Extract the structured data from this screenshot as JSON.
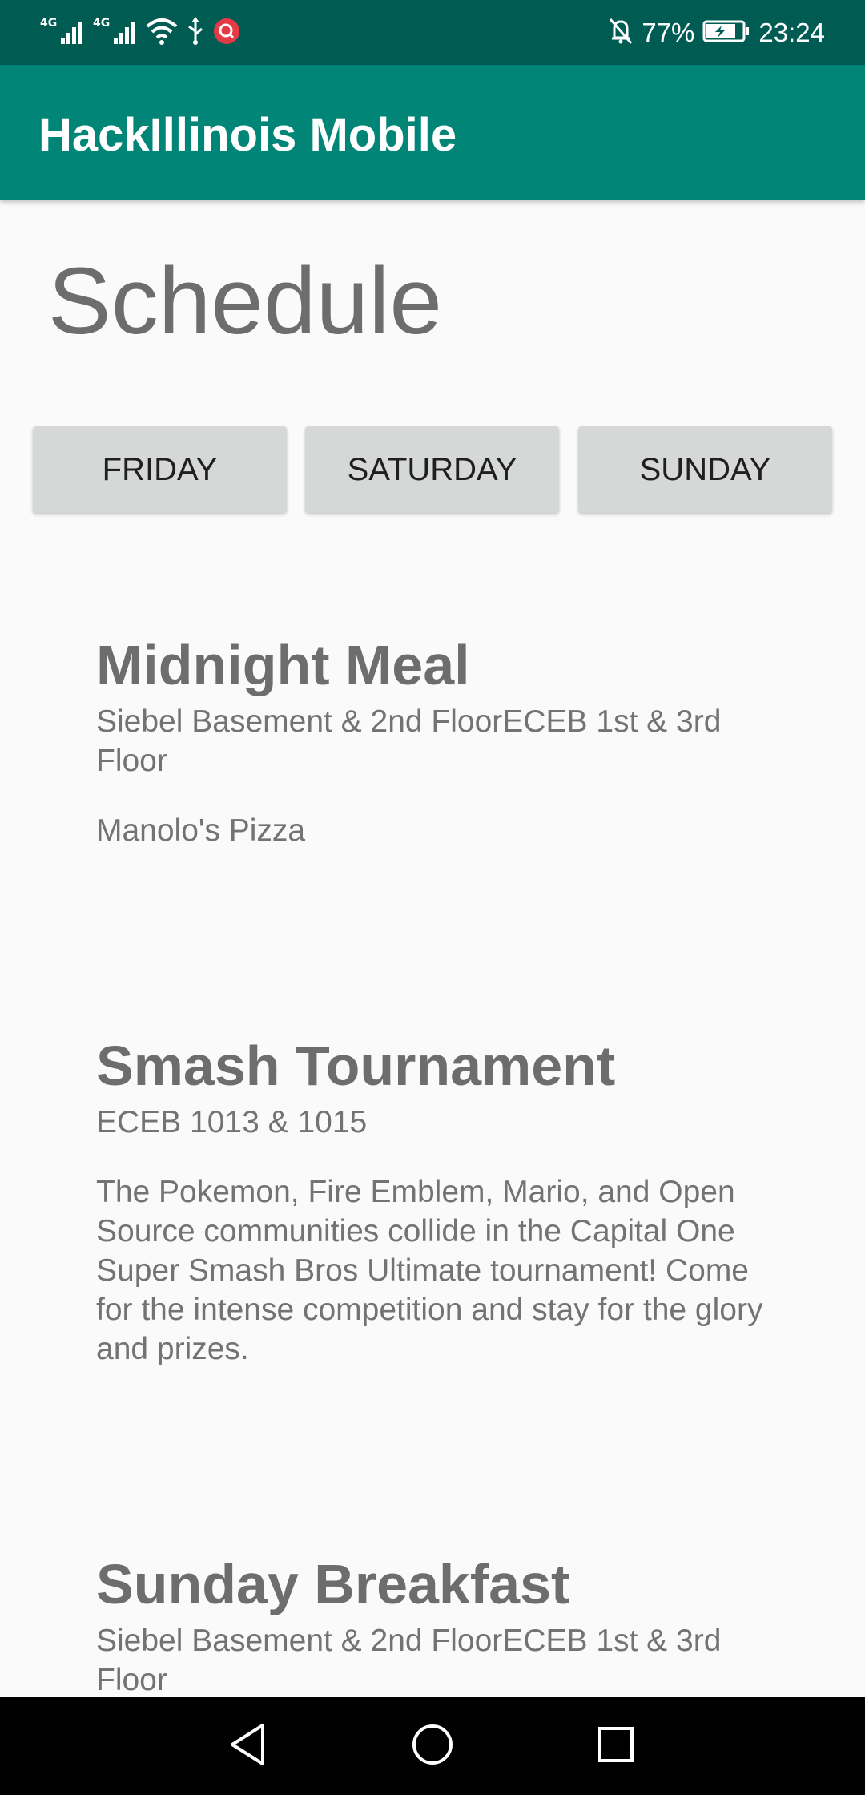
{
  "status_bar": {
    "signal_1": "4G",
    "signal_2": "4G",
    "battery_percent": "77%",
    "time": "23:24",
    "background": "#005c52",
    "icons": [
      "signal-4g-icon",
      "signal-4g-icon",
      "wifi-icon",
      "usb-icon",
      "notification-app-icon",
      "mute-bell-icon",
      "battery-charging-icon"
    ]
  },
  "app_bar": {
    "title": "HackIllinois Mobile",
    "color": "#008577"
  },
  "page": {
    "heading": "Schedule"
  },
  "day_tabs": [
    {
      "label": "FRIDAY"
    },
    {
      "label": "SATURDAY"
    },
    {
      "label": "SUNDAY"
    }
  ],
  "events": [
    {
      "title": "Midnight Meal",
      "location": "Siebel Basement & 2nd FloorECEB 1st & 3rd Floor",
      "description": "Manolo's Pizza"
    },
    {
      "title": "Smash Tournament",
      "location": "ECEB 1013 & 1015",
      "description": "The Pokemon, Fire Emblem, Mario, and Open Source communities collide in the Capital One Super Smash Bros Ultimate tournament! Come for the intense competition and stay for the glory and prizes."
    },
    {
      "title": "Sunday Breakfast",
      "location": "Siebel Basement & 2nd FloorECEB 1st & 3rd Floor",
      "description": ""
    }
  ],
  "nav_bar": {
    "icons": [
      "back-icon",
      "home-icon",
      "recents-icon"
    ]
  }
}
